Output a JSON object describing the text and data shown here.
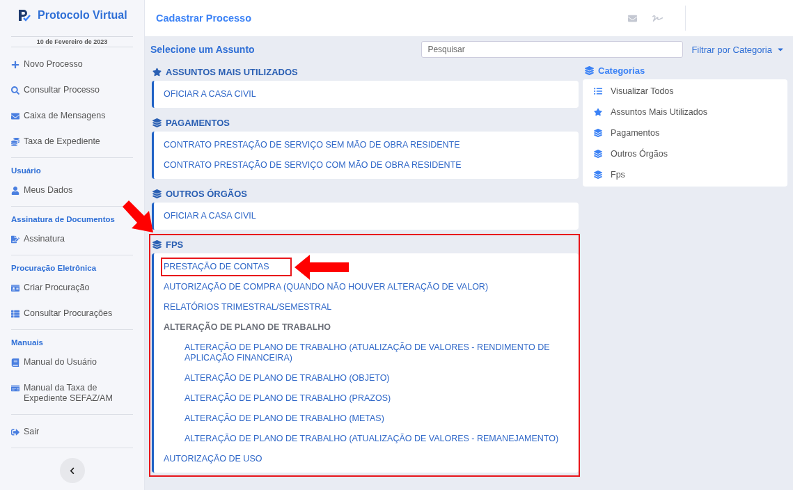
{
  "app": {
    "name": "Protocolo Virtual",
    "date": "10 de Fevereiro de 2023"
  },
  "sidebar": {
    "groups": [
      {
        "items": [
          {
            "label": "Novo Processo",
            "kind": "plus"
          },
          {
            "label": "Consultar Processo",
            "kind": "search"
          },
          {
            "label": "Caixa de Mensagens",
            "kind": "mail"
          },
          {
            "label": "Taxa de Expediente",
            "kind": "coins"
          }
        ]
      },
      {
        "heading": "Usuário",
        "items": [
          {
            "label": "Meus Dados",
            "kind": "user"
          }
        ]
      },
      {
        "heading": "Assinatura de Documentos",
        "items": [
          {
            "label": "Assinatura",
            "kind": "signature"
          }
        ]
      },
      {
        "heading": "Procuração Eletrônica",
        "items": [
          {
            "label": "Criar Procuração",
            "kind": "card"
          },
          {
            "label": "Consultar Procurações",
            "kind": "table"
          }
        ]
      },
      {
        "heading": "Manuais",
        "items": [
          {
            "label": "Manual do Usuário",
            "kind": "book"
          },
          {
            "label": "Manual da Taxa de Expediente SEFAZ/AM",
            "kind": "money"
          }
        ]
      },
      {
        "items": [
          {
            "label": "Sair",
            "kind": "logout"
          }
        ]
      }
    ]
  },
  "header": {
    "title": "Cadastrar Processo"
  },
  "toolbar": {
    "title": "Selecione um Assunto",
    "search": {
      "placeholder": "Pesquisar"
    },
    "filter": "Filtrar por Categoria"
  },
  "sections": [
    {
      "title": "ASSUNTOS MAIS UTILIZADOS",
      "kind": "star",
      "highlighted": false,
      "items": [
        {
          "label": "OFICIAR A CASA CIVIL",
          "highlighted": false
        }
      ]
    },
    {
      "title": "PAGAMENTOS",
      "kind": "layers",
      "highlighted": false,
      "items": [
        {
          "label": "CONTRATO PRESTAÇÃO DE SERVIÇO SEM MÃO DE OBRA RESIDENTE",
          "highlighted": false
        },
        {
          "label": "CONTRATO PRESTAÇÃO DE SERVIÇO COM MÃO DE OBRA RESIDENTE",
          "highlighted": false
        }
      ]
    },
    {
      "title": "OUTROS ÓRGÃOS",
      "kind": "layers",
      "highlighted": false,
      "items": [
        {
          "label": "OFICIAR A CASA CIVIL",
          "highlighted": false
        }
      ]
    },
    {
      "title": "FPS",
      "kind": "layers",
      "highlighted": true,
      "items": [
        {
          "label": "PRESTAÇÃO DE CONTAS",
          "highlighted": true
        },
        {
          "label": "AUTORIZAÇÃO DE COMPRA (QUANDO NÃO HOUVER ALTERAÇÃO DE VALOR)",
          "highlighted": false
        },
        {
          "label": "RELATÓRIOS TRIMESTRAL/SEMESTRAL",
          "highlighted": false
        },
        {
          "label": "ALTERAÇÃO DE PLANO DE TRABALHO",
          "highlighted": false,
          "children": [
            {
              "label": "ALTERAÇÃO DE PLANO DE TRABALHO (ATUALIZAÇÃO DE VALORES - RENDIMENTO DE APLICAÇÃO FINANCEIRA)",
              "highlighted": false
            },
            {
              "label": "ALTERAÇÃO DE PLANO DE TRABALHO (OBJETO)",
              "highlighted": false
            },
            {
              "label": "ALTERAÇÃO DE PLANO DE TRABALHO (PRAZOS)",
              "highlighted": false
            },
            {
              "label": "ALTERAÇÃO DE PLANO DE TRABALHO (METAS)",
              "highlighted": false
            },
            {
              "label": "ALTERAÇÃO DE PLANO DE TRABALHO (ATUALIZAÇÃO DE VALORES - REMANEJAMENTO)",
              "highlighted": false
            }
          ]
        },
        {
          "label": "AUTORIZAÇÃO DE USO",
          "highlighted": false
        }
      ]
    }
  ],
  "categories": {
    "title": "Categorias",
    "items": [
      {
        "label": "Visualizar Todos",
        "kind": "list"
      },
      {
        "label": "Assuntos Mais Utilizados",
        "kind": "star"
      },
      {
        "label": "Pagamentos",
        "kind": "layers"
      },
      {
        "label": "Outros Órgãos",
        "kind": "layers"
      },
      {
        "label": "Fps",
        "kind": "layers"
      }
    ]
  }
}
